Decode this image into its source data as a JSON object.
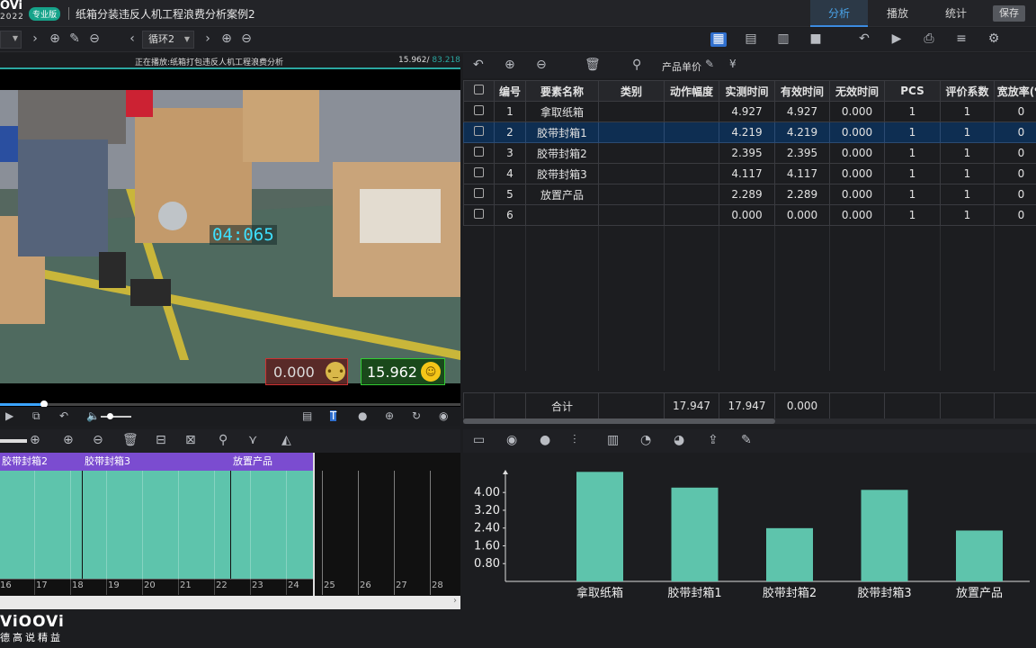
{
  "app": {
    "logo": "OVi",
    "year": "2022",
    "edition": "专业版",
    "doc_title": "纸箱分装违反人机工程浪费分析案例2"
  },
  "tabs": {
    "analysis": "分析",
    "play": "播放",
    "stats": "统计",
    "save": "保存"
  },
  "toolbar": {
    "cycle": "循环2"
  },
  "video": {
    "now_playing": "正在播放:纸箱打包违反人机工程浪费分析",
    "current_time": "15.962",
    "total_time": "83.218",
    "overlay_timer": "04:065",
    "invalid_value": "0.000",
    "valid_value": "15.962",
    "progress_fraction": 0.09
  },
  "element_panel": {
    "price_label": "产品单价"
  },
  "table": {
    "headers": [
      "编号",
      "要素名称",
      "类别",
      "动作幅度",
      "实测时间",
      "有效时间",
      "无效时间",
      "PCS",
      "评价系数",
      "宽放率(%"
    ],
    "rows": [
      {
        "no": "1",
        "name": "拿取纸箱",
        "cat": "",
        "amp": "",
        "measured": "4.927",
        "valid": "4.927",
        "invalid": "0.000",
        "pcs": "1",
        "coef": "1",
        "allow": "0",
        "selected": false
      },
      {
        "no": "2",
        "name": "胶带封箱1",
        "cat": "",
        "amp": "",
        "measured": "4.219",
        "valid": "4.219",
        "invalid": "0.000",
        "pcs": "1",
        "coef": "1",
        "allow": "0",
        "selected": true
      },
      {
        "no": "3",
        "name": "胶带封箱2",
        "cat": "",
        "amp": "",
        "measured": "2.395",
        "valid": "2.395",
        "invalid": "0.000",
        "pcs": "1",
        "coef": "1",
        "allow": "0",
        "selected": false
      },
      {
        "no": "4",
        "name": "胶带封箱3",
        "cat": "",
        "amp": "",
        "measured": "4.117",
        "valid": "4.117",
        "invalid": "0.000",
        "pcs": "1",
        "coef": "1",
        "allow": "0",
        "selected": false
      },
      {
        "no": "5",
        "name": "放置产品",
        "cat": "",
        "amp": "",
        "measured": "2.289",
        "valid": "2.289",
        "invalid": "0.000",
        "pcs": "1",
        "coef": "1",
        "allow": "0",
        "selected": false
      },
      {
        "no": "6",
        "name": "",
        "cat": "",
        "amp": "",
        "measured": "0.000",
        "valid": "0.000",
        "invalid": "0.000",
        "pcs": "1",
        "coef": "1",
        "allow": "0",
        "selected": false
      }
    ],
    "total": {
      "label": "合计",
      "measured": "17.947",
      "valid": "17.947",
      "invalid": "0.000"
    }
  },
  "timeline": {
    "segments": [
      "胶带封箱2",
      "胶带封箱3",
      "放置产品"
    ],
    "ticks": [
      "16",
      "17",
      "18",
      "19",
      "20",
      "21",
      "22",
      "23",
      "24",
      "25",
      "26",
      "27",
      "28"
    ]
  },
  "chart_data": {
    "type": "bar",
    "categories": [
      "拿取纸箱",
      "胶带封箱1",
      "胶带封箱2",
      "胶带封箱3",
      "放置产品"
    ],
    "values": [
      4.927,
      4.219,
      2.395,
      4.117,
      2.289
    ],
    "yticks": [
      "4.00",
      "3.20",
      "2.40",
      "1.60",
      "0.80"
    ],
    "ylim": [
      0,
      4.98
    ],
    "bar_color": "#5ec4ac"
  },
  "watermark": {
    "brand": "ViOOVi",
    "slogan": "德高说精益"
  },
  "colors": {
    "accent": "#3b8be0",
    "teal": "#2aa6a0",
    "selected_row": "#0e2e52"
  }
}
